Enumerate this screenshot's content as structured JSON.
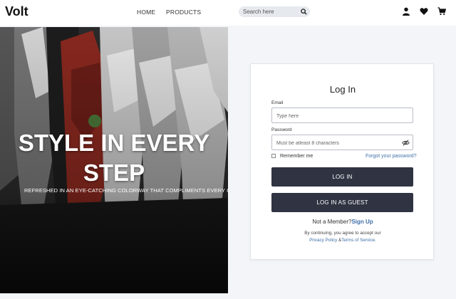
{
  "header": {
    "logo": "Volt",
    "nav": {
      "home": "HOME",
      "products": "PRODUCTS"
    },
    "search": {
      "placeholder": "Search here",
      "icon": "search-icon"
    },
    "icons": [
      "user-icon",
      "heart-icon",
      "cart-icon"
    ]
  },
  "hero": {
    "title_line1": "STYLE IN EVERY",
    "title_line2": "STEP",
    "subtitle": "REFRESHED IN AN EYE-CATCHING COLORWAY THAT COMPLIMENTS EVERY OUTFIT."
  },
  "login": {
    "title": "Log In",
    "email_label": "Email",
    "email_placeholder": "Type here",
    "password_label": "Password",
    "password_placeholder": "Must be atleast 8 characters",
    "remember_label": "Remember me",
    "forgot_link": "Forgot your password?",
    "login_button": "LOG IN",
    "guest_button": "LOG IN AS GUEST",
    "member_prompt": "Not a Member?",
    "signup_link": "Sign Up",
    "terms_prefix": "By continuing, you agree to accept our",
    "privacy_link": "Privacy Policy",
    "terms_joiner": " &",
    "terms_link": "Terms of Service",
    "terms_suffix": "."
  },
  "colors": {
    "button": "#2f3342",
    "link": "#3d6ea8",
    "page_bg": "#f3f5f8"
  }
}
